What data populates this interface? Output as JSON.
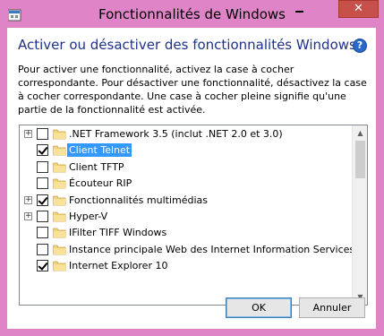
{
  "window": {
    "title": "Fonctionnalités de Windows",
    "close_glyph": "✕"
  },
  "header": {
    "title": "Activer ou désactiver des fonctionnalités Windows",
    "help_glyph": "?"
  },
  "description": "Pour activer une fonctionnalité, activez la case à cocher correspondante. Pour désactiver une fonctionnalité, désactivez la case à cocher correspondante. Une case à cocher pleine signifie qu'une partie de la fonctionnalité est activée.",
  "features": [
    {
      "label": ".NET Framework 3.5 (inclut .NET 2.0 et 3.0)",
      "checked": false,
      "expandable": true,
      "selected": false
    },
    {
      "label": "Client Telnet",
      "checked": true,
      "expandable": false,
      "selected": true
    },
    {
      "label": "Client TFTP",
      "checked": false,
      "expandable": false,
      "selected": false
    },
    {
      "label": "Écouteur RIP",
      "checked": false,
      "expandable": false,
      "selected": false
    },
    {
      "label": "Fonctionnalités multimédias",
      "checked": true,
      "expandable": true,
      "selected": false
    },
    {
      "label": "Hyper-V",
      "checked": false,
      "expandable": true,
      "selected": false
    },
    {
      "label": "IFilter TIFF Windows",
      "checked": false,
      "expandable": false,
      "selected": false
    },
    {
      "label": "Instance principale Web des Internet Information Services (IIS",
      "checked": false,
      "expandable": false,
      "selected": false
    },
    {
      "label": "Internet Explorer 10",
      "checked": true,
      "expandable": false,
      "selected": false
    }
  ],
  "buttons": {
    "ok": "OK",
    "cancel": "Annuler"
  },
  "colors": {
    "frame": "#e084c8",
    "header_text": "#1e3287",
    "selection": "#3399ff",
    "close_button": "#c7504a"
  },
  "icons": {
    "window": "windows-features-icon",
    "folder": "folder-icon",
    "help": "help-icon"
  }
}
